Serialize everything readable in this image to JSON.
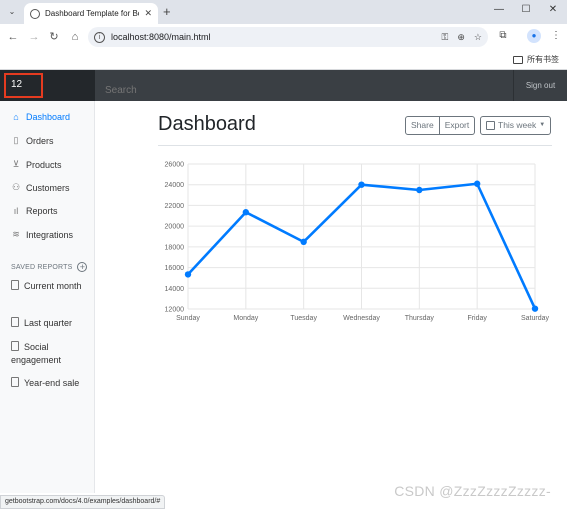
{
  "browser": {
    "tab_title": "Dashboard Template for Boo",
    "tab_close": "✕",
    "new_tab": "+",
    "url": "localhost:8080/main.html",
    "bookmarks_folder": "所有书签"
  },
  "navbar": {
    "brand": "12",
    "search_placeholder": "Search",
    "signout": "Sign out"
  },
  "sidebar": {
    "items": [
      {
        "label": "Dashboard",
        "icon": "home-icon",
        "active": true
      },
      {
        "label": "Orders",
        "icon": "file-icon"
      },
      {
        "label": "Products",
        "icon": "cart-icon"
      },
      {
        "label": "Customers",
        "icon": "users-icon"
      },
      {
        "label": "Reports",
        "icon": "bar-chart-icon"
      },
      {
        "label": "Integrations",
        "icon": "layers-icon"
      }
    ],
    "saved_reports_heading": "SAVED REPORTS",
    "reports": [
      {
        "label": "Current month"
      },
      {
        "label": "Last quarter"
      },
      {
        "label": "Social engagement"
      },
      {
        "label": "Year-end sale"
      }
    ]
  },
  "main": {
    "title": "Dashboard",
    "share": "Share",
    "export": "Export",
    "week": "This week"
  },
  "chart_data": {
    "type": "line",
    "categories": [
      "Sunday",
      "Monday",
      "Tuesday",
      "Wednesday",
      "Thursday",
      "Friday",
      "Saturday"
    ],
    "series": [
      {
        "values": [
          15339,
          21345,
          18483,
          24003,
          23489,
          24092,
          12034
        ]
      }
    ],
    "ylim": [
      12000,
      26000
    ],
    "yticks": [
      12000,
      14000,
      16000,
      18000,
      20000,
      22000,
      24000,
      26000
    ],
    "line_color": "#007bff",
    "grid": true
  },
  "statusbar": "getbootstrap.com/docs/4.0/examples/dashboard/#",
  "watermark": "CSDN @ZzzZzzzZzzzz-"
}
